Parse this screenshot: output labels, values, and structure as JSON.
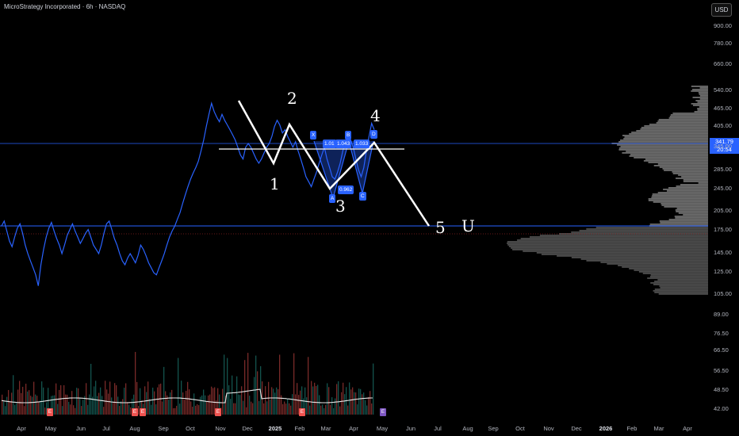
{
  "header": {
    "title": "MicroStrategy Incorporated · 6h · NASDAQ",
    "currency_button": "USD"
  },
  "price_tag": {
    "price": "341.79",
    "countdown": "20:54"
  },
  "y_axis_labels": [
    "900.00",
    "780.00",
    "660.00",
    "540.00",
    "465.00",
    "405.00",
    "345.00",
    "285.00",
    "245.00",
    "205.00",
    "175.00",
    "145.00",
    "125.00",
    "105.00",
    "89.00",
    "76.50",
    "66.50",
    "56.50",
    "48.50",
    "42.00"
  ],
  "x_axis_labels": [
    "Apr",
    "May",
    "Jun",
    "Jul",
    "Aug",
    "Sep",
    "Oct",
    "Nov",
    "Dec",
    "2025",
    "Feb",
    "Mar",
    "Apr",
    "May",
    "Jun",
    "Jul",
    "Aug",
    "Sep",
    "Oct",
    "Nov",
    "Dec",
    "2026",
    "Feb",
    "Mar",
    "Apr"
  ],
  "pattern_points": {
    "x": "X",
    "a": "A",
    "b": "B",
    "c": "C",
    "d": "D"
  },
  "pattern_ratios": {
    "xab": "1.01",
    "abc": "1.043",
    "bcd": "1.033",
    "xad": "0.962"
  },
  "handwritten_labels": {
    "one": "1",
    "two": "2",
    "three": "3",
    "four": "4",
    "five": "5",
    "target": "U"
  },
  "earnings_marker": "E",
  "colors": {
    "price_line": "#2962ff",
    "background": "#000000",
    "annotation": "#ffffff",
    "volume_up": "#26a69a",
    "volume_down": "#ef5350",
    "accent": "#2962ff"
  },
  "chart_data": {
    "type": "line",
    "series": [
      {
        "values": [
          175,
          182,
          168,
          155,
          148,
          160,
          172,
          178,
          165,
          150,
          140,
          132,
          125,
          118,
          108,
          128,
          145,
          160,
          172,
          180,
          168,
          158,
          150,
          140,
          150,
          162,
          170,
          178,
          168,
          160,
          152,
          158,
          165,
          170,
          160,
          150,
          145,
          140,
          150,
          165,
          178,
          182,
          170,
          158,
          150,
          140,
          132,
          128,
          135,
          140,
          135,
          130,
          138,
          150,
          145,
          138,
          130,
          125,
          120,
          118,
          125,
          132,
          140,
          150,
          160,
          168,
          175,
          185,
          195,
          210,
          225,
          240,
          255,
          268,
          280,
          295,
          320,
          350,
          390,
          430,
          470,
          440,
          420,
          405,
          430,
          410,
          395,
          380,
          365,
          350,
          330,
          310,
          300,
          330,
          340,
          330,
          315,
          300,
          290,
          300,
          315,
          330,
          340,
          360,
          390,
          410,
          395,
          370,
          380,
          360,
          345,
          330,
          345,
          320,
          300,
          280,
          260,
          250,
          240,
          255,
          270,
          290,
          310,
          330,
          300,
          280,
          260,
          255,
          270,
          290,
          320,
          345,
          370,
          350,
          330,
          300,
          275,
          260,
          280,
          320,
          360,
          400,
          380
        ]
      }
    ],
    "ylim": [
      42,
      900
    ],
    "y_scale": "log"
  }
}
